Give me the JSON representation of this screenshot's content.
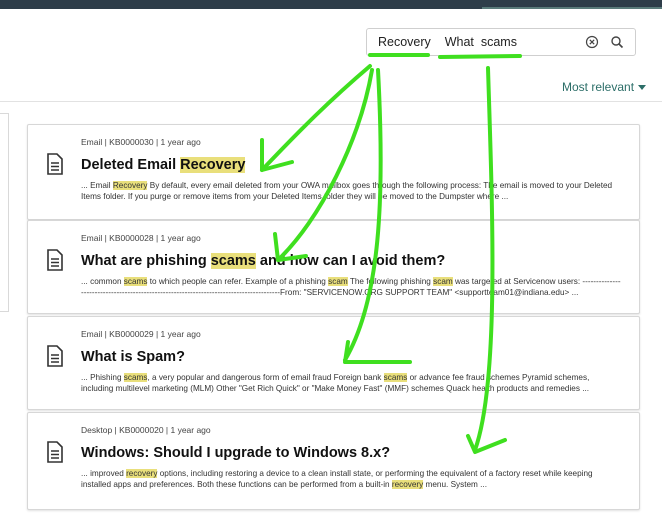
{
  "search": {
    "query_word1": "Recovery",
    "query_word2": "What",
    "query_word3": "scams"
  },
  "sort": {
    "label": "Most relevant"
  },
  "colors": {
    "highlight": "#e9df7b",
    "accent": "#2c6e68",
    "annotation": "#3fdf1f"
  },
  "results": [
    {
      "meta": "Email | KB0000030 | 1 year ago",
      "title_pre": "Deleted Email ",
      "title_hl": "Recovery",
      "title_post": "",
      "s1_pre": "... Email ",
      "s1_hl": "Recovery",
      "s1_post": " By default, every email deleted from your OWA mailbox goes through the following process: The email is moved to your Deleted Items folder. If you purge or remove items from your Deleted Items folder they will be moved to the Dumpster where ..."
    },
    {
      "meta": "Email | KB0000028 | 1 year ago",
      "title_pre": "What are phishing ",
      "title_hl": "scams",
      "title_post": " and how can I avoid them?",
      "s1_pre": "... common ",
      "s1_hl": "scams",
      "s1_mid1": " to which people can refer. Example of a phishing ",
      "s1_hl2": "scam",
      "s1_mid2": " The following phishing ",
      "s1_hl3": "scam",
      "s1_post": " was targeted at Servicenow users: ---------------------------------------------------------------------------------------From: \"SERVICENOW.ORG SUPPORT TEAM\" <supportteam01@indiana.edu> ..."
    },
    {
      "meta": "Email | KB0000029 | 1 year ago",
      "title_pre": "What is Spam?",
      "s1_pre": "... Phishing ",
      "s1_hl": "scams",
      "s1_mid1": ", a very popular and dangerous form of email fraud Foreign bank ",
      "s1_hl2": "scams",
      "s1_post": " or advance fee fraud schemes Pyramid schemes, including multilevel marketing (MLM) Other \"Get Rich Quick\" or \"Make Money Fast\" (MMF) schemes Quack health products and remedies ..."
    },
    {
      "meta": "Desktop | KB0000020 | 1 year ago",
      "title_pre": "Windows: Should I upgrade to Windows 8.x?",
      "s1_pre": "... improved ",
      "s1_hl": "recovery",
      "s1_mid1": " options, including restoring a device to a clean install state, or performing the equivalent of a factory reset while keeping installed apps and preferences. Both these functions can be performed from a built-in ",
      "s1_hl2": "recovery",
      "s1_post": " menu.   System ..."
    }
  ]
}
